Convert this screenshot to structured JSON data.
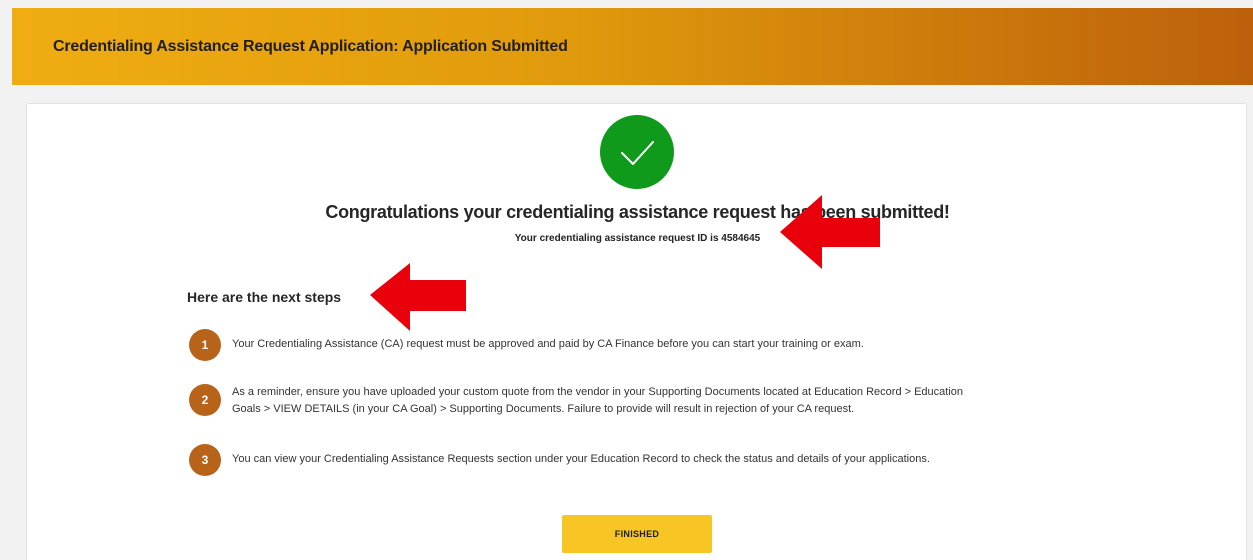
{
  "header": {
    "title": "Credentialing Assistance Request Application: Application Submitted"
  },
  "success": {
    "icon": "check-circle-icon",
    "heading": "Congratulations your credentialing assistance request has been submitted!",
    "request_id_text": "Your credentialing assistance request ID is 4584645"
  },
  "next_steps": {
    "heading": "Here are the next steps",
    "steps": [
      {
        "number": "1",
        "text": "Your Credentialing Assistance (CA) request must be approved and paid by CA Finance before you can start your training or exam."
      },
      {
        "number": "2",
        "text_line1": "As a reminder, ensure you have uploaded your custom quote from the vendor in your Supporting Documents located at Education Record > Education",
        "text_line2": "Goals > VIEW DETAILS (in your CA Goal) > Supporting Documents. Failure to provide will result in rejection of your CA request."
      },
      {
        "number": "3",
        "text": "You can view your Credentialing Assistance Requests section under your Education Record to check the status and details of your applications."
      }
    ]
  },
  "actions": {
    "finished_label": "FINISHED"
  },
  "colors": {
    "header_start": "#f0ad12",
    "header_end": "#bd600c",
    "success_green": "#109a1c",
    "step_badge": "#b7631a",
    "button_yellow": "#f7c625",
    "annotation_red": "#e8000b"
  }
}
